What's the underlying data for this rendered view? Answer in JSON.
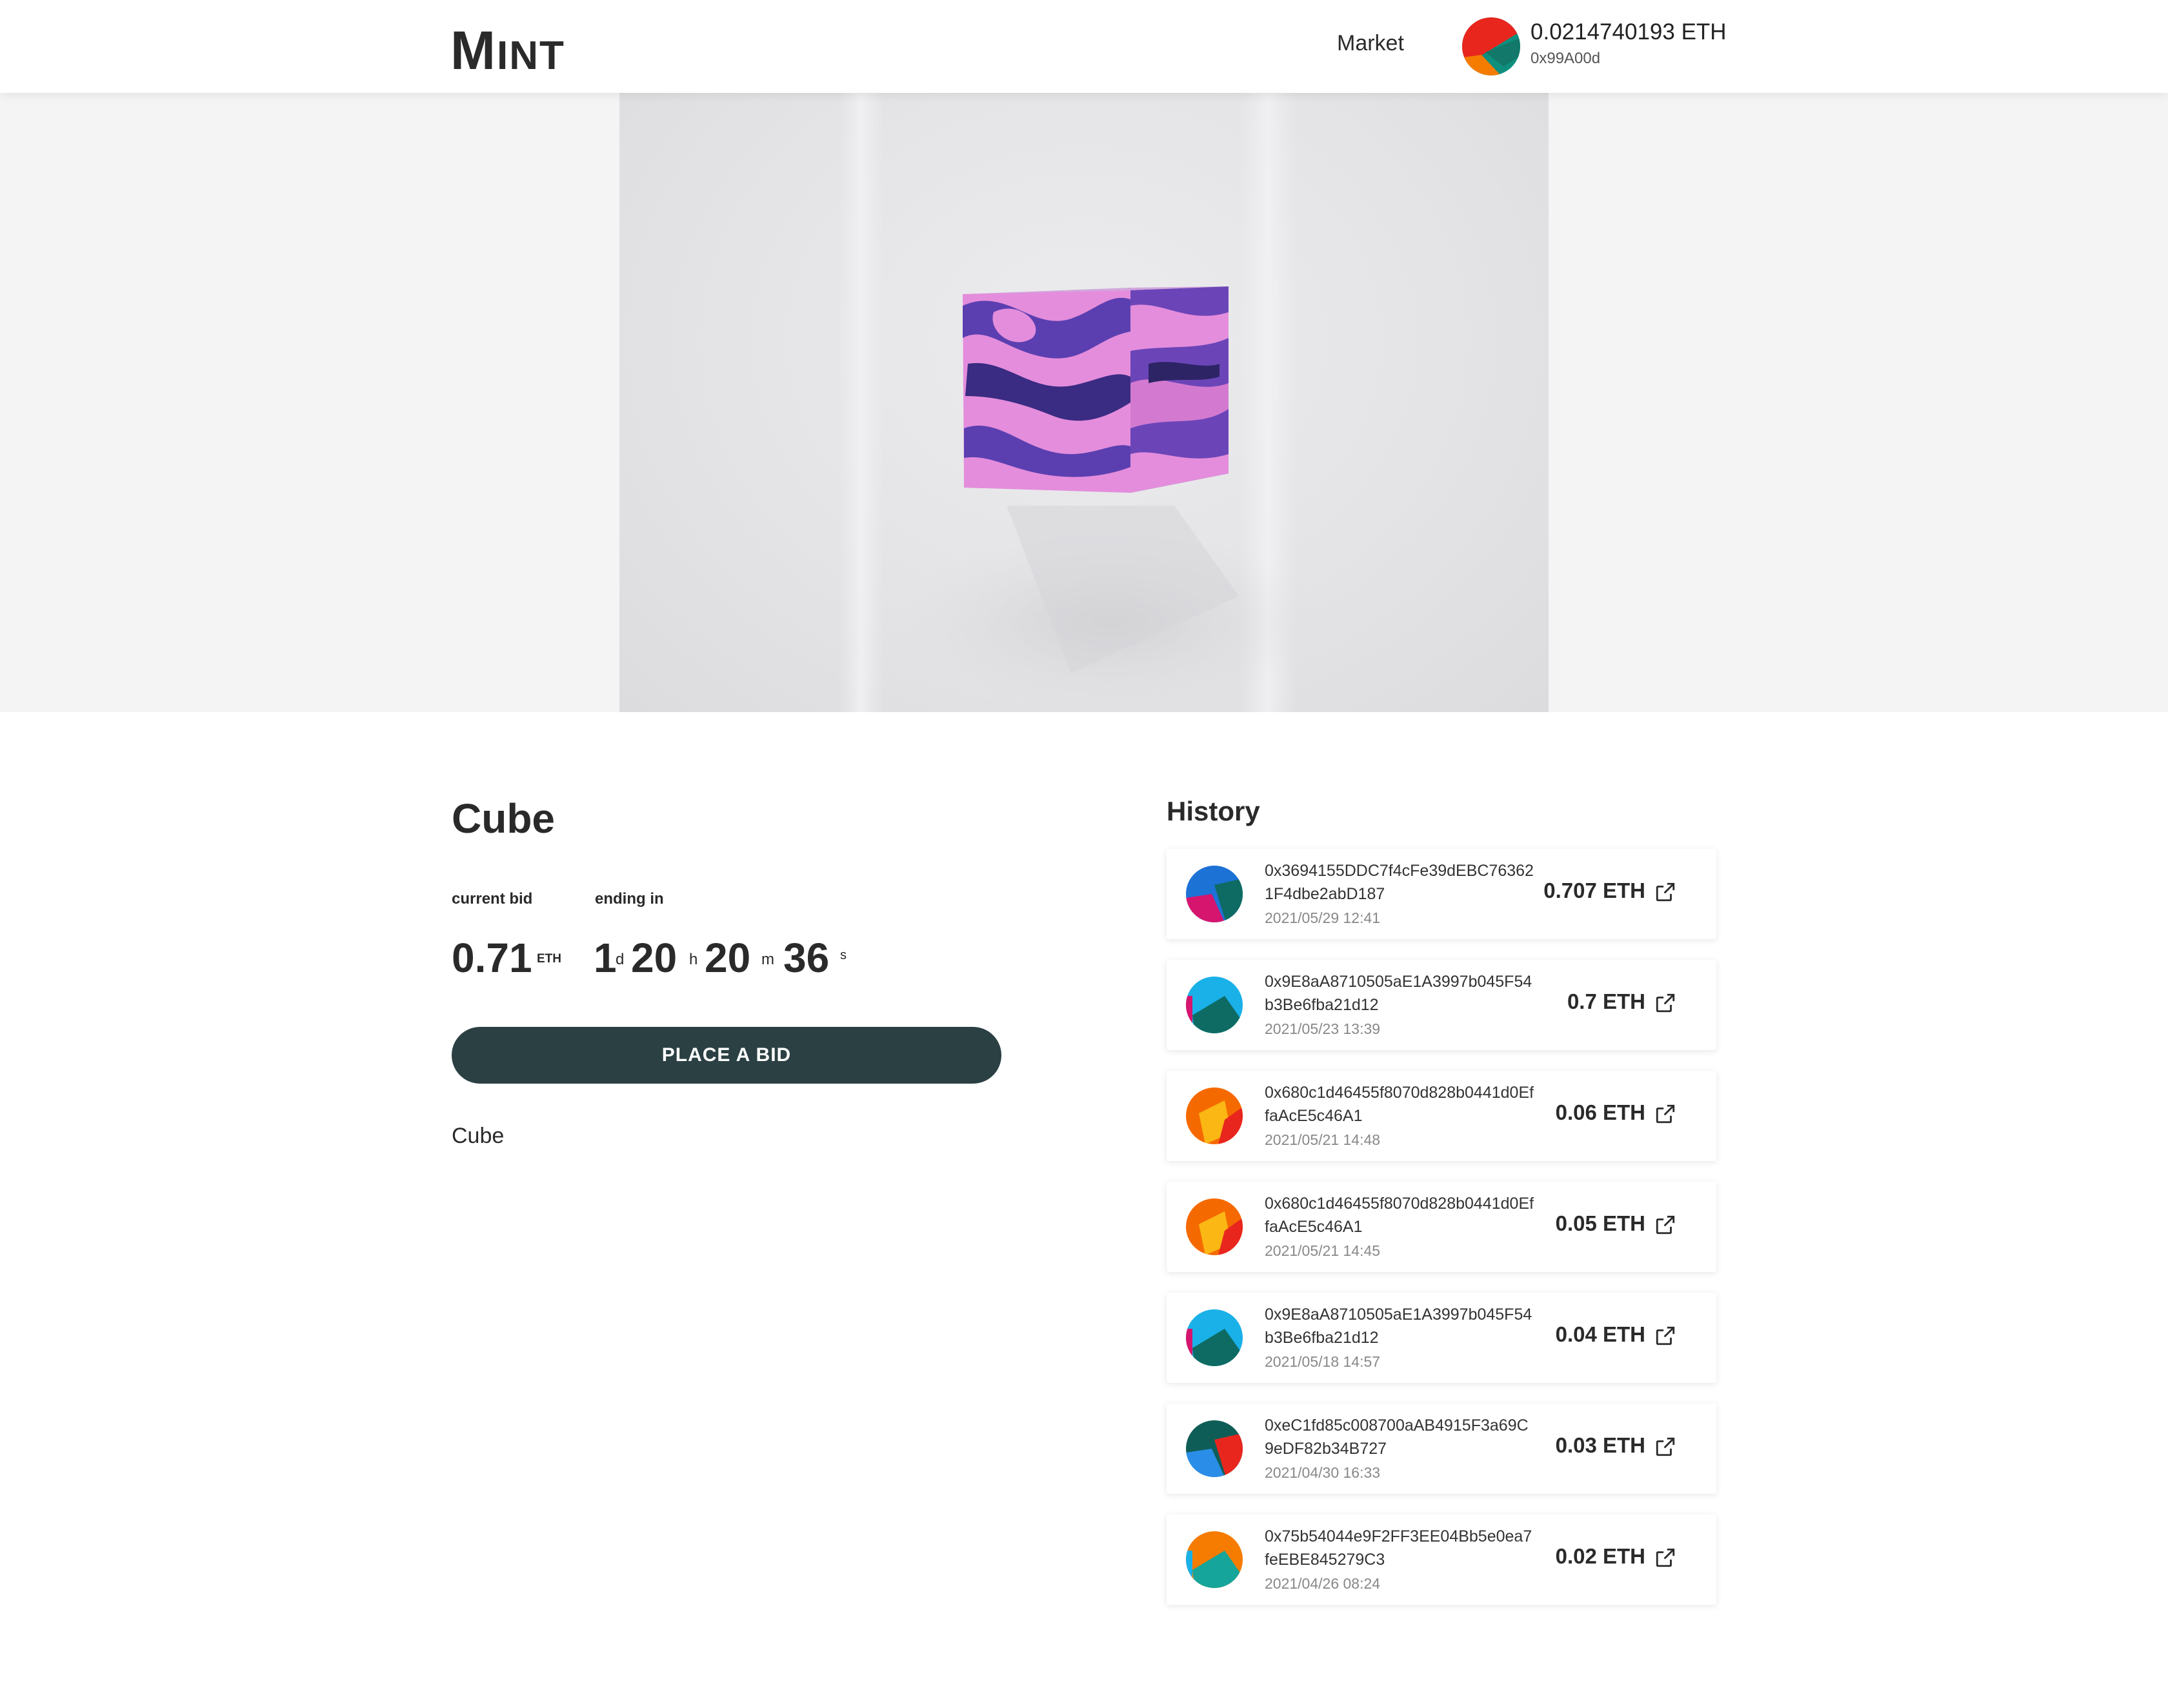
{
  "header": {
    "logo_big": "M",
    "logo_small": "INT",
    "nav_market": "Market",
    "wallet_balance": "0.0214740193 ETH",
    "wallet_address": "0x99A00d",
    "wallet_avatar_colors": [
      "#e8261e",
      "#0e8f7e",
      "#f57c00"
    ]
  },
  "hero": {
    "image_name": "purple marble cube",
    "cube_colors": [
      "#e98be0",
      "#5b3fb0",
      "#2d2466"
    ]
  },
  "item": {
    "title": "Cube",
    "current_bid_label": "current bid",
    "ending_in_label": "ending in",
    "bid_value": "0.71",
    "bid_unit": "ETH",
    "countdown": {
      "days": "1",
      "days_unit": "d",
      "hours": "20",
      "hours_unit": "h",
      "minutes": "20",
      "minutes_unit": "m",
      "seconds": "36",
      "seconds_unit": "s"
    },
    "button_label": "PLACE A BID",
    "description": "Cube"
  },
  "history": {
    "title": "History",
    "icons": {
      "external_link": "external-link-icon"
    },
    "rows": [
      {
        "address": "0x3694155DDC7f4cFe39dEBC763621F4dbe2abD187",
        "date": "2021/05/29 12:41",
        "amount": "0.707 ETH",
        "colors": [
          "#1d72d6",
          "#d6156e",
          "#0e6b63"
        ]
      },
      {
        "address": "0x9E8aA8710505aE1A3997b045F54b3Be6fba21d12",
        "date": "2021/05/23 13:39",
        "amount": "0.7 ETH",
        "colors": [
          "#1ab0e8",
          "#0e6b63",
          "#d6156e"
        ]
      },
      {
        "address": "0x680c1d46455f8070d828b0441d0EffaAcE5c46A1",
        "date": "2021/05/21 14:48",
        "amount": "0.06 ETH",
        "colors": [
          "#f56a00",
          "#fbb714",
          "#e8261e"
        ]
      },
      {
        "address": "0x680c1d46455f8070d828b0441d0EffaAcE5c46A1",
        "date": "2021/05/21 14:45",
        "amount": "0.05 ETH",
        "colors": [
          "#f56a00",
          "#fbb714",
          "#e8261e"
        ]
      },
      {
        "address": "0x9E8aA8710505aE1A3997b045F54b3Be6fba21d12",
        "date": "2021/05/18 14:57",
        "amount": "0.04 ETH",
        "colors": [
          "#1ab0e8",
          "#0e6b63",
          "#d6156e"
        ]
      },
      {
        "address": "0xeC1fd85c008700aAB4915F3a69C9eDF82b34B727",
        "date": "2021/04/30 16:33",
        "amount": "0.03 ETH",
        "colors": [
          "#0e5e57",
          "#2a8ee8",
          "#e8261e"
        ]
      },
      {
        "address": "0x75b54044e9F2FF3EE04Bb5e0ea7feEBE845279C3",
        "date": "2021/04/26 08:24",
        "amount": "0.02 ETH",
        "colors": [
          "#f57c00",
          "#16a59a",
          "#1ab0e8"
        ]
      }
    ]
  }
}
